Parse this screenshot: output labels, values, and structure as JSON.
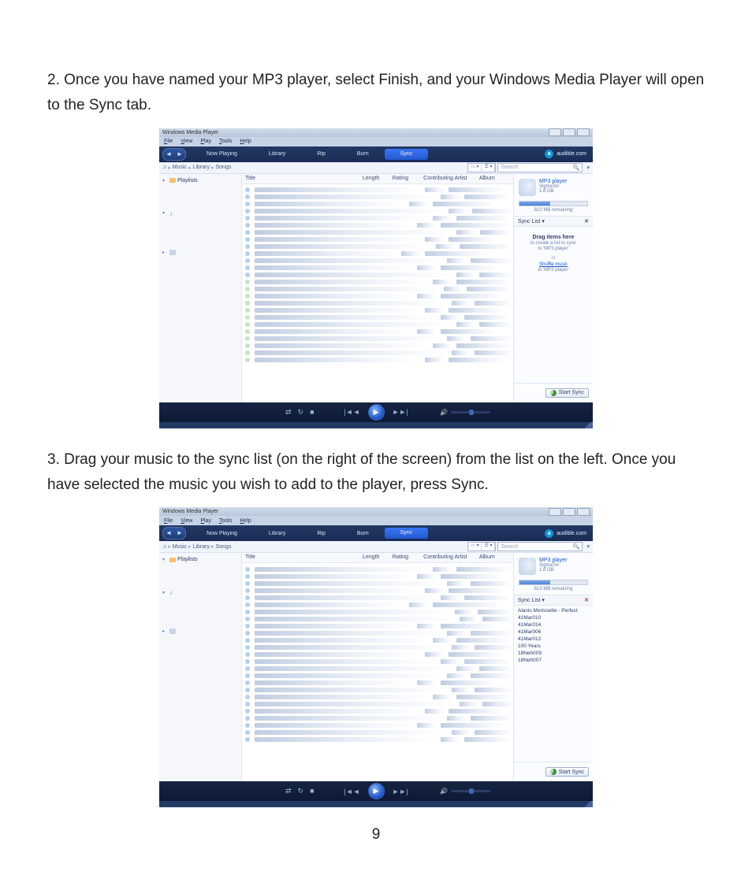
{
  "instruction_step2": "2. Once you have named your MP3 player, select Finish, and your Windows Media Player will open to the Sync tab.",
  "instruction_step3": "3. Drag your music to the sync list (on the right of the screen) from the list on the left. Once you have selected the music you wish to add to the player, press Sync.",
  "page_number": "9",
  "wmp": {
    "title": "Windows Media Player",
    "menu": [
      "File",
      "View",
      "Play",
      "Tools",
      "Help"
    ],
    "tabs": {
      "now_playing": "Now Playing",
      "library": "Library",
      "rip": "Rip",
      "burn": "Burn",
      "sync": "Sync",
      "audible": "audible.com"
    },
    "breadcrumbs": [
      "Music",
      "Library",
      "Songs"
    ],
    "search_placeholder": "Search",
    "leftnav": {
      "playlists": "Playlists"
    },
    "columns": {
      "title": "Title",
      "length": "Length",
      "rating": "Rating",
      "contrib": "Contributing Artist",
      "album": "Album"
    },
    "device": {
      "name": "MP3 player",
      "brand": "SigmaTel",
      "size": "1.8 GB",
      "remaining_1": "822 MB remaining",
      "remaining_2": "813 MB remaining"
    },
    "synclist": {
      "header": "Sync List",
      "drag": "Drag items here",
      "sub1": "to create a list to sync",
      "sub2": "to 'MP3 player'",
      "or": "or",
      "shuffle": "Shuffle music",
      "shuffle_sub": "to 'MP3 player'",
      "start_sync": "Start Sync",
      "items": [
        "Alanis Morissette - Perfect",
        "41Mar010",
        "41Mar014",
        "41Mar006",
        "41Mar012",
        "100 Years",
        "18Neh009",
        "18Neh007"
      ]
    }
  }
}
